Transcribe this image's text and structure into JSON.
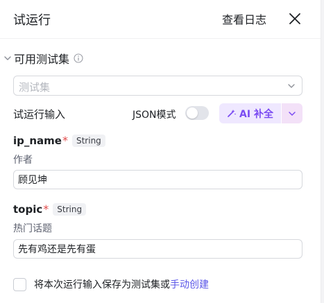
{
  "header": {
    "title": "试运行",
    "logs_label": "查看日志"
  },
  "test_sets": {
    "title": "可用测试集",
    "select_placeholder": "测试集"
  },
  "run_input": {
    "label": "试运行输入",
    "json_mode_label": "JSON模式",
    "json_mode_on": false,
    "ai_fill_label": "AI 补全"
  },
  "params": [
    {
      "name": "ip_name",
      "required_mark": "*",
      "type": "String",
      "description": "作者",
      "value": "顾见坤"
    },
    {
      "name": "topic",
      "required_mark": "*",
      "type": "String",
      "description": "热门话题",
      "value": "先有鸡还是先有蛋"
    }
  ],
  "footer": {
    "save_text": "将本次运行输入保存为测试集或",
    "manual_link": "手动创建",
    "checked": false
  },
  "colors": {
    "accent": "#7b4cf2",
    "link": "#5b57e8",
    "required": "#e24a4a"
  }
}
